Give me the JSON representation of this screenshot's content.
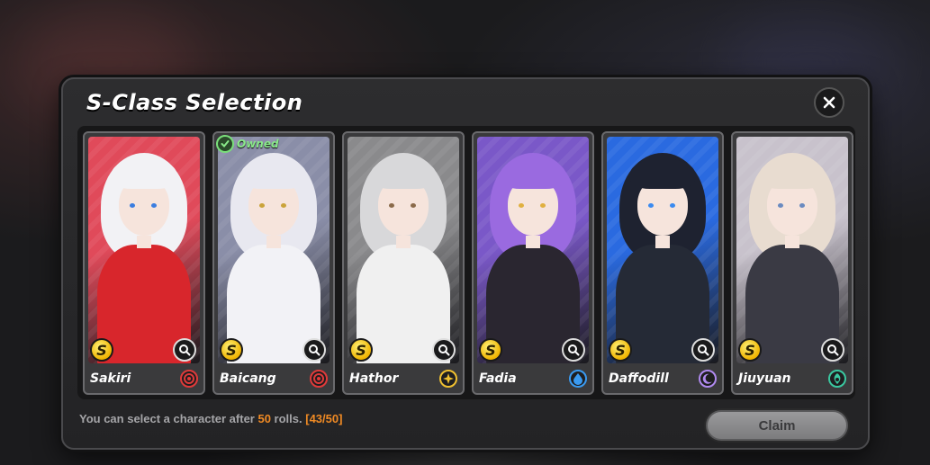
{
  "title": "S-Class Selection",
  "cards": [
    {
      "name": "Sakiri",
      "rank": "S",
      "owned": false,
      "bg": "#e04a5a",
      "hair": "#f2f2f5",
      "outfit": "#d8262c",
      "attr_color": "#e03a3a",
      "attr_icon": "fire-element-icon",
      "eye": "#3a7de0"
    },
    {
      "name": "Baicang",
      "rank": "S",
      "owned": true,
      "bg": "#8a8ea8",
      "hair": "#e8e8f0",
      "outfit": "#f2f2f6",
      "attr_color": "#e03a3a",
      "attr_icon": "fire-element-icon",
      "eye": "#caa33a"
    },
    {
      "name": "Hathor",
      "rank": "S",
      "owned": false,
      "bg": "#8a8a8c",
      "hair": "#d8d8da",
      "outfit": "#f0f0f0",
      "attr_color": "#f0c030",
      "attr_icon": "light-element-icon",
      "eye": "#8a6a4a"
    },
    {
      "name": "Fadia",
      "rank": "S",
      "owned": false,
      "bg": "#7a58c8",
      "hair": "#9a6ae0",
      "outfit": "#2a2630",
      "attr_color": "#3a9af0",
      "attr_icon": "water-element-icon",
      "eye": "#e0b040"
    },
    {
      "name": "Daffodill",
      "rank": "S",
      "owned": false,
      "bg": "#2a6ae0",
      "hair": "#1e2230",
      "outfit": "#252a36",
      "attr_color": "#b08af0",
      "attr_icon": "moon-element-icon",
      "eye": "#3a8af0"
    },
    {
      "name": "Jiuyuan",
      "rank": "S",
      "owned": false,
      "bg": "#c8c2cc",
      "hair": "#e8dcd0",
      "outfit": "#3a3a44",
      "attr_color": "#3ac8a0",
      "attr_icon": "wind-element-icon",
      "eye": "#6a8ac0"
    }
  ],
  "owned_label": "Owned",
  "footer": {
    "prefix": "You can select a character after ",
    "rolls": "50",
    "middle": " rolls. ",
    "progress": "[43/50]"
  },
  "claim_label": "Claim"
}
